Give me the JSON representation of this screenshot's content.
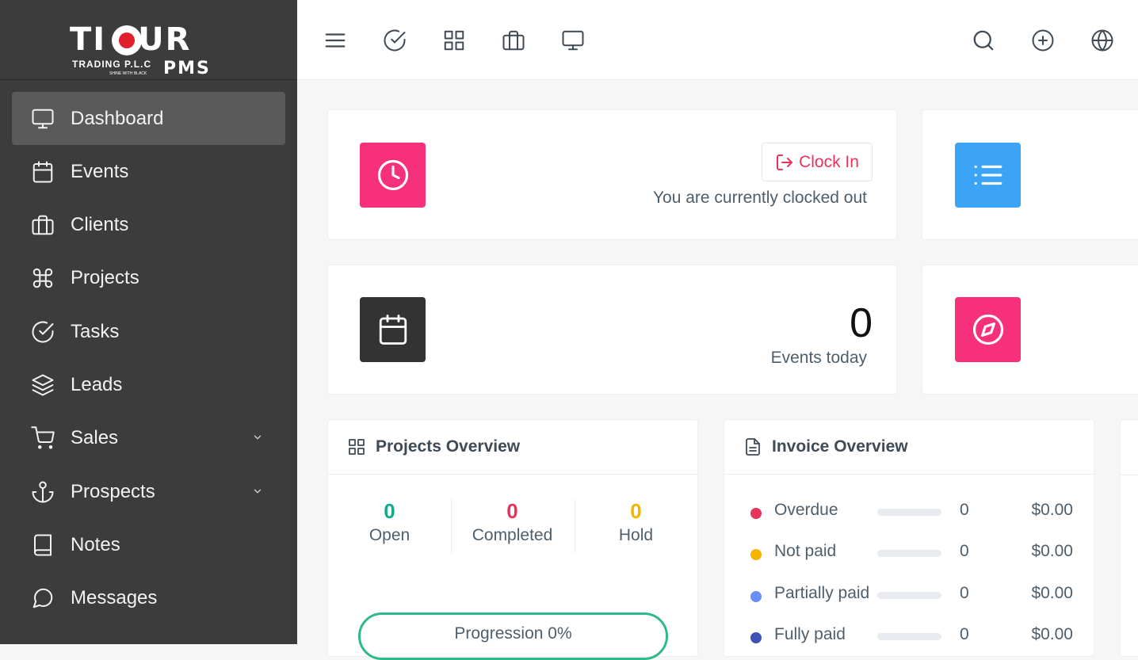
{
  "brand": {
    "line1": "TI",
    "line1b": "UR",
    "trading": "TRADING P.L.C",
    "tagline": "SHINE WITH BLACK",
    "pms": "PMS"
  },
  "sidebar": {
    "items": [
      {
        "label": "Dashboard",
        "icon": "monitor-icon",
        "active": true
      },
      {
        "label": "Events",
        "icon": "calendar-icon"
      },
      {
        "label": "Clients",
        "icon": "briefcase-icon"
      },
      {
        "label": "Projects",
        "icon": "command-icon"
      },
      {
        "label": "Tasks",
        "icon": "check-circle-icon"
      },
      {
        "label": "Leads",
        "icon": "layers-icon"
      },
      {
        "label": "Sales",
        "icon": "cart-icon",
        "has_submenu": true
      },
      {
        "label": "Prospects",
        "icon": "anchor-icon",
        "has_submenu": true
      },
      {
        "label": "Notes",
        "icon": "book-icon"
      },
      {
        "label": "Messages",
        "icon": "message-icon"
      }
    ]
  },
  "topbar": {
    "left_icons": [
      "menu-icon",
      "check-circle-icon",
      "grid-icon",
      "briefcase-icon",
      "monitor-icon"
    ],
    "right_icons": [
      "search-icon",
      "plus-circle-icon",
      "globe-icon"
    ]
  },
  "clock_card": {
    "button_label": "Clock In",
    "status_text": "You are currently clocked out",
    "icon_color": "#f6307a"
  },
  "events_card": {
    "count": "0",
    "label": "Events today"
  },
  "projects_overview": {
    "title": "Projects Overview",
    "stats": [
      {
        "value": "0",
        "label": "Open",
        "color": "#13a98b"
      },
      {
        "value": "0",
        "label": "Completed",
        "color": "#e8345a"
      },
      {
        "value": "0",
        "label": "Hold",
        "color": "#f5b400"
      }
    ],
    "progression_label": "Progression 0%"
  },
  "invoice_overview": {
    "title": "Invoice Overview",
    "rows": [
      {
        "label": "Overdue",
        "count": "0",
        "amount": "$0.00",
        "color": "#e8345a"
      },
      {
        "label": "Not paid",
        "count": "0",
        "amount": "$0.00",
        "color": "#f5b400"
      },
      {
        "label": "Partially paid",
        "count": "0",
        "amount": "$0.00",
        "color": "#6690f4"
      },
      {
        "label": "Fully paid",
        "count": "0",
        "amount": "$0.00",
        "color": "#3f51b5"
      }
    ]
  }
}
